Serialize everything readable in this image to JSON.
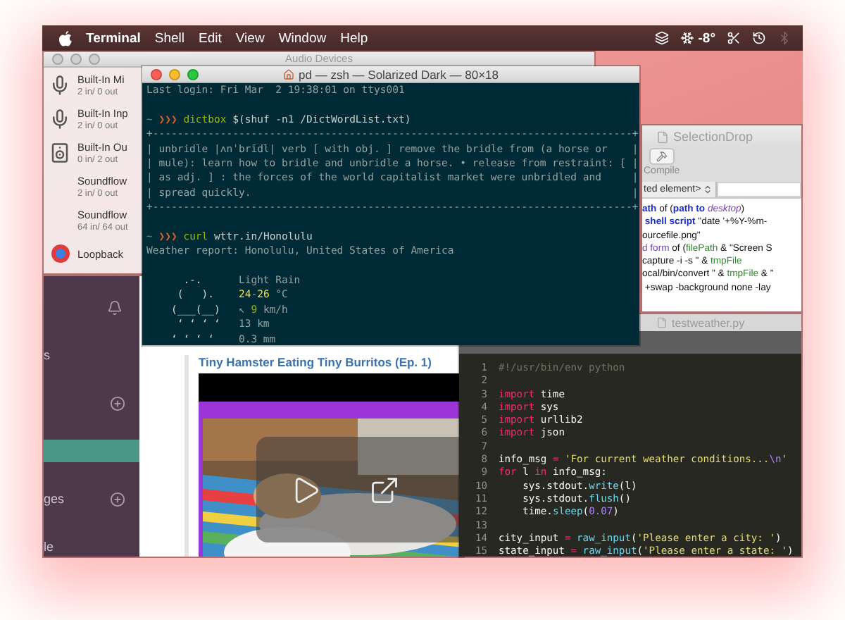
{
  "menu_bar": {
    "app_name": "Terminal",
    "menus": [
      "Shell",
      "Edit",
      "View",
      "Window",
      "Help"
    ],
    "temperature": "-8°",
    "bluetooth_on": false
  },
  "audio_window": {
    "title": "Audio Devices",
    "devices": [
      {
        "name": "Built-In Mi",
        "io": "2 in/ 0 out",
        "kind": "microphone"
      },
      {
        "name": "Built-In Inp",
        "io": "2 in/ 0 out",
        "kind": "microphone"
      },
      {
        "name": "Built-In Ou",
        "io": "0 in/ 2 out",
        "kind": "speaker"
      },
      {
        "name": "Soundflow",
        "io": "2 in/ 0 out",
        "kind": "virtual"
      },
      {
        "name": "Soundflow",
        "io": "64 in/ 64 out",
        "kind": "virtual"
      },
      {
        "name": "Loopback",
        "kind": "loopback"
      }
    ]
  },
  "chat_window": {
    "sidebar": [
      {
        "kind": "bell"
      },
      {
        "kind": "item",
        "label": "s",
        "selected": false
      },
      {
        "kind": "header"
      },
      {
        "kind": "item",
        "selected": true
      },
      {
        "kind": "header",
        "label": "ges"
      },
      {
        "kind": "item",
        "label": "le",
        "selected": false
      }
    ],
    "attachment": {
      "title": "Tiny Hamster Eating Tiny Burritos (Ep. 1)"
    }
  },
  "terminal": {
    "title": "pd — zsh — Solarized Dark — 80×18",
    "lines": [
      {
        "kind": "text",
        "segments": [
          {
            "text": "Last login: Fri Mar  2 19:38:01 on ttys001",
            "kind": "base"
          }
        ]
      },
      {
        "kind": "blank"
      },
      {
        "kind": "text",
        "segments": [
          {
            "text": "~ ",
            "kind": "cyan"
          },
          {
            "text": "❯❯❯ ",
            "kind": "orange"
          },
          {
            "text": "dictbox",
            "kind": "green"
          },
          {
            "text": " $(shuf -n1 /DictWordList.txt)",
            "kind": "bright"
          }
        ]
      },
      {
        "kind": "text",
        "segments": [
          {
            "text": "+------------------------------------------------------------------------------+",
            "kind": "base"
          }
        ]
      },
      {
        "kind": "text",
        "segments": [
          {
            "text": "| unbridle |ʌnˈbrīdl| verb [ with obj. ] remove the bridle from (a horse or    |",
            "kind": "base"
          }
        ]
      },
      {
        "kind": "text",
        "segments": [
          {
            "text": "| mule): learn how to bridle and unbridle a horse. • release from restraint: [ |",
            "kind": "base"
          }
        ]
      },
      {
        "kind": "text",
        "segments": [
          {
            "text": "| as adj. ] : the forces of the world capitalist market were unbridled and     |",
            "kind": "base"
          }
        ]
      },
      {
        "kind": "text",
        "segments": [
          {
            "text": "| spread quickly.                                                              |",
            "kind": "base"
          }
        ]
      },
      {
        "kind": "text",
        "segments": [
          {
            "text": "+------------------------------------------------------------------------------+",
            "kind": "base"
          }
        ]
      },
      {
        "kind": "blank"
      },
      {
        "kind": "text",
        "segments": [
          {
            "text": "~ ",
            "kind": "cyan"
          },
          {
            "text": "❯❯❯ ",
            "kind": "orange"
          },
          {
            "text": "curl",
            "kind": "green"
          },
          {
            "text": " wttr.in/Honolulu",
            "kind": "bright"
          }
        ]
      },
      {
        "kind": "text",
        "segments": [
          {
            "text": "Weather report: Honolulu, United States of America",
            "kind": "base"
          }
        ]
      },
      {
        "kind": "blank"
      },
      {
        "kind": "weather",
        "art": "      .-.",
        "segments": [
          {
            "text": "Light Rain",
            "kind": "base"
          }
        ]
      },
      {
        "kind": "weather",
        "art": "     (   ).",
        "segments": [
          {
            "text": "24",
            "kind": "yellow"
          },
          {
            "text": "-",
            "kind": "base"
          },
          {
            "text": "26",
            "kind": "yellow"
          },
          {
            "text": " °C",
            "kind": "base"
          }
        ]
      },
      {
        "kind": "weather",
        "art": "    (___(__)",
        "segments": [
          {
            "text": "↖ ",
            "kind": "base"
          },
          {
            "text": "9",
            "kind": "green"
          },
          {
            "text": " km/h",
            "kind": "base"
          }
        ]
      },
      {
        "kind": "weather",
        "art": "     ‘ ‘ ‘ ‘",
        "segments": [
          {
            "text": "13 km",
            "kind": "base"
          }
        ]
      },
      {
        "kind": "weather",
        "art": "    ‘ ‘ ‘ ‘",
        "segments": [
          {
            "text": "0.3 mm",
            "kind": "base"
          }
        ]
      }
    ]
  },
  "script_window": {
    "title": "SelectionDrop",
    "toolbar": [
      "Compile"
    ],
    "element_menu": "ted element>",
    "lines": [
      [
        {
          "text": "ath",
          "kind": "keyword"
        },
        {
          "text": " of (",
          "kind": "plain"
        },
        {
          "text": "path to",
          "kind": "keyword"
        },
        {
          "text": " desktop",
          "kind": "class"
        },
        {
          "text": ")",
          "kind": "plain"
        }
      ],
      [
        {
          "text": " shell script",
          "kind": "keyword"
        },
        {
          "text": " \"date '+%Y-%m-",
          "kind": "plain"
        }
      ],
      [
        {
          "text": "ourcefile.png\"",
          "kind": "plain"
        }
      ],
      [
        {
          "text": "d form",
          "kind": "command"
        },
        {
          "text": " of (",
          "kind": "plain"
        },
        {
          "text": "filePath",
          "kind": "variable"
        },
        {
          "text": " & \"Screen S",
          "kind": "plain"
        }
      ],
      [
        {
          "text": "capture -i -s \" & ",
          "kind": "plain"
        },
        {
          "text": "tmpFile",
          "kind": "variable"
        }
      ],
      [
        {
          "text": "ocal/bin/convert \" & ",
          "kind": "plain"
        },
        {
          "text": "tmpFile",
          "kind": "variable"
        },
        {
          "text": " & \"",
          "kind": "plain"
        }
      ],
      [
        {
          "text": " +swap -background none -lay",
          "kind": "plain"
        }
      ]
    ]
  },
  "editor": {
    "tab": "testweather.py",
    "lines": [
      {
        "number": "1",
        "tokens": [
          {
            "text": "#!/usr/bin/env python",
            "kind": "comment"
          }
        ]
      },
      {
        "number": "2"
      },
      {
        "number": "3",
        "tokens": [
          {
            "text": "import",
            "kind": "keyword"
          },
          {
            "text": " time",
            "kind": "plain"
          }
        ]
      },
      {
        "number": "4",
        "tokens": [
          {
            "text": "import",
            "kind": "keyword"
          },
          {
            "text": " sys",
            "kind": "plain"
          }
        ]
      },
      {
        "number": "5",
        "tokens": [
          {
            "text": "import",
            "kind": "keyword"
          },
          {
            "text": " urllib2",
            "kind": "plain"
          }
        ]
      },
      {
        "number": "6",
        "tokens": [
          {
            "text": "import",
            "kind": "keyword"
          },
          {
            "text": " json",
            "kind": "plain"
          }
        ]
      },
      {
        "number": "7"
      },
      {
        "number": "8",
        "tokens": [
          {
            "text": "info_msg ",
            "kind": "plain"
          },
          {
            "text": "=",
            "kind": "keyword"
          },
          {
            "text": " 'For current weather conditions...",
            "kind": "string"
          },
          {
            "text": "\\n",
            "kind": "number"
          },
          {
            "text": "'",
            "kind": "string"
          }
        ]
      },
      {
        "number": "9",
        "tokens": [
          {
            "text": "for",
            "kind": "keyword"
          },
          {
            "text": " l ",
            "kind": "plain"
          },
          {
            "text": "in",
            "kind": "keyword"
          },
          {
            "text": " info_msg:",
            "kind": "plain"
          }
        ]
      },
      {
        "number": "10",
        "tokens": [
          {
            "text": "    sys.stdout.",
            "kind": "plain"
          },
          {
            "text": "write",
            "kind": "function"
          },
          {
            "text": "(l)",
            "kind": "plain"
          }
        ]
      },
      {
        "number": "11",
        "tokens": [
          {
            "text": "    sys.stdout.",
            "kind": "plain"
          },
          {
            "text": "flush",
            "kind": "function"
          },
          {
            "text": "()",
            "kind": "plain"
          }
        ]
      },
      {
        "number": "12",
        "tokens": [
          {
            "text": "    time.",
            "kind": "plain"
          },
          {
            "text": "sleep",
            "kind": "function"
          },
          {
            "text": "(",
            "kind": "plain"
          },
          {
            "text": "0.07",
            "kind": "number"
          },
          {
            "text": ")",
            "kind": "plain"
          }
        ]
      },
      {
        "number": "13"
      },
      {
        "number": "14",
        "tokens": [
          {
            "text": "city_input ",
            "kind": "plain"
          },
          {
            "text": "=",
            "kind": "keyword"
          },
          {
            "text": " raw_input",
            "kind": "function"
          },
          {
            "text": "(",
            "kind": "plain"
          },
          {
            "text": "'Please enter a city: '",
            "kind": "string"
          },
          {
            "text": ")",
            "kind": "plain"
          }
        ]
      },
      {
        "number": "15",
        "tokens": [
          {
            "text": "state_input ",
            "kind": "plain"
          },
          {
            "text": "=",
            "kind": "keyword"
          },
          {
            "text": " raw_input",
            "kind": "function"
          },
          {
            "text": "(",
            "kind": "plain"
          },
          {
            "text": "'Please enter a state: '",
            "kind": "string"
          },
          {
            "text": ")",
            "kind": "plain"
          }
        ]
      }
    ]
  }
}
